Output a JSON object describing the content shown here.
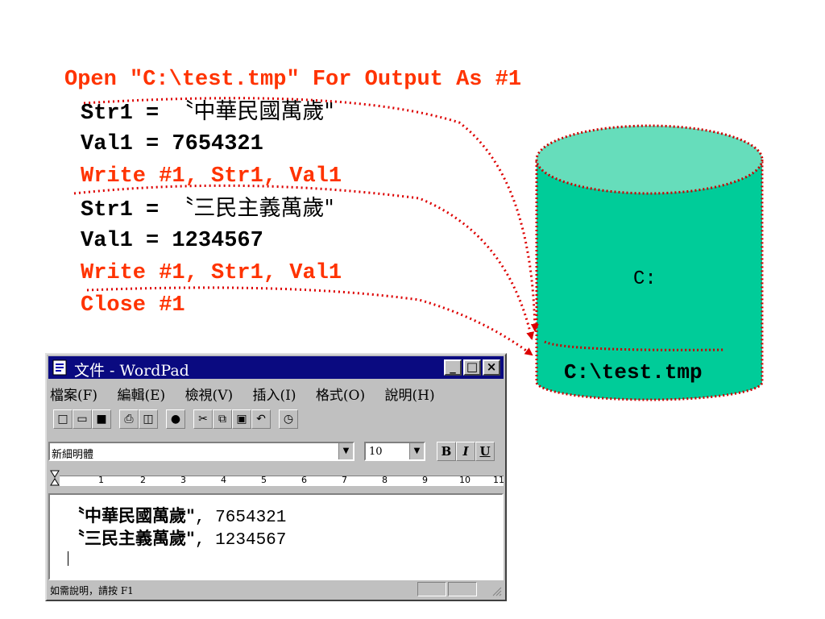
{
  "code": {
    "line1": "Open \"C:\\test.tmp\" For Output As #1",
    "line2_prefix": "Str1 = ",
    "line2_string": "〝中華民國萬歲\"",
    "line3": "Val1 = 7654321",
    "line4": "Write #1, Str1, Val1",
    "line5_prefix": "Str1 = ",
    "line5_string": "〝三民主義萬歲\"",
    "line6": "Val1 = 1234567",
    "line7": "Write #1, Str1, Val1",
    "line8": "Close #1"
  },
  "cylinder": {
    "drive_label": "C:",
    "file_label": "C:\\test.tmp",
    "colors": {
      "body": "#00cc99",
      "top": "#66ddbb",
      "dotted_arrow": "#dd0000"
    }
  },
  "wordpad": {
    "title": "文件 - WordPad",
    "window_buttons": [
      "_",
      "□",
      "×"
    ],
    "menu": [
      "檔案(F)",
      "編輯(E)",
      "檢視(V)",
      "插入(I)",
      "格式(O)",
      "說明(H)"
    ],
    "font_name": "新細明體",
    "font_size": "10",
    "format_buttons": [
      "B",
      "I",
      "U"
    ],
    "ruler_numbers": [
      "1",
      "2",
      "3",
      "4",
      "5",
      "6",
      "7",
      "8",
      "9",
      "10",
      "11"
    ],
    "doc_lines": [
      {
        "zh": "〝中華民國萬歲\"",
        "rest": ", 7654321"
      },
      {
        "zh": "〝三民主義萬歲\"",
        "rest": ", 1234567"
      }
    ],
    "status_text": "如需說明，請按 F1"
  }
}
